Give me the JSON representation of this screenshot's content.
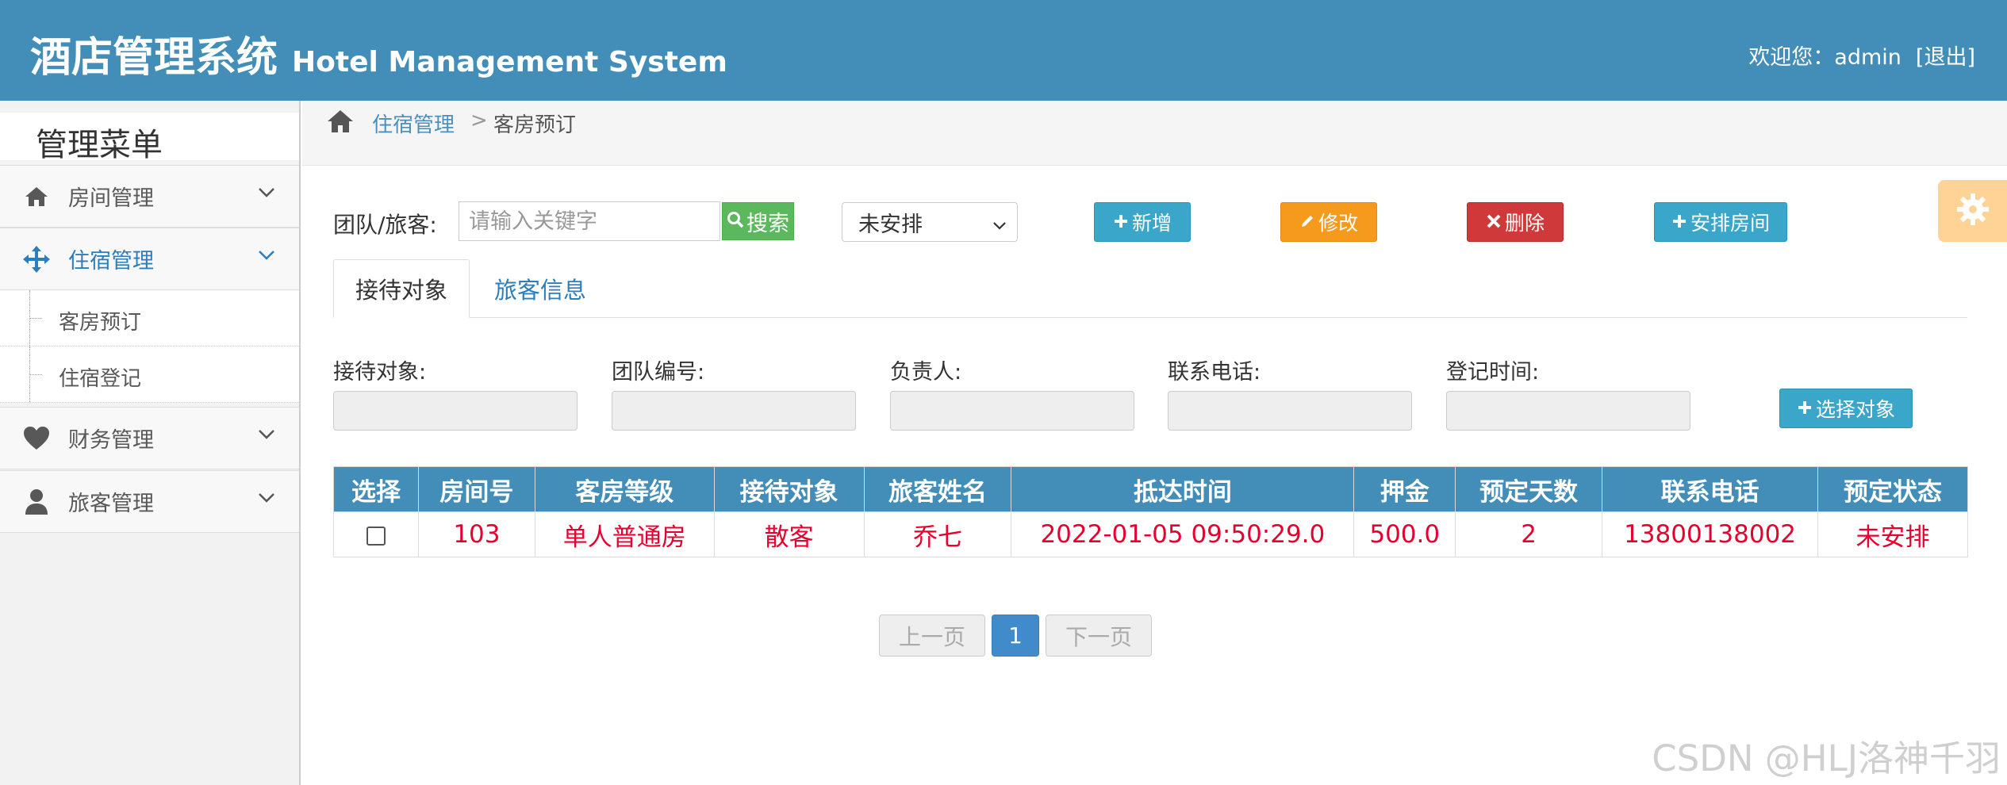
{
  "header": {
    "title_cn": "酒店管理系统",
    "title_en": "Hotel Management System",
    "welcome": "欢迎您：admin",
    "logout": "[退出]"
  },
  "sidebar": {
    "menu_title": "管理菜单",
    "items": [
      {
        "label": "房间管理",
        "icon": "home-icon"
      },
      {
        "label": "住宿管理",
        "icon": "arrows-move-icon",
        "active": true
      },
      {
        "label": "财务管理",
        "icon": "heart-icon"
      },
      {
        "label": "旅客管理",
        "icon": "user-icon"
      }
    ],
    "subitems": [
      {
        "label": "客房预订"
      },
      {
        "label": "住宿登记"
      }
    ]
  },
  "breadcrumb": {
    "parent": "住宿管理",
    "separator": ">",
    "current": "客房预订"
  },
  "toolbar": {
    "label": "团队/旅客:",
    "search_placeholder": "请输入关键字",
    "search_label": "搜索",
    "select_value": "未安排",
    "add_label": "新增",
    "edit_label": "修改",
    "delete_label": "删除",
    "arrange_label": "安排房间"
  },
  "tabs": [
    {
      "label": "接待对象"
    },
    {
      "label": "旅客信息"
    }
  ],
  "form": {
    "fields": [
      {
        "label": "接待对象:"
      },
      {
        "label": "团队编号:"
      },
      {
        "label": "负责人:"
      },
      {
        "label": "联系电话:"
      },
      {
        "label": "登记时间:"
      }
    ],
    "select_label": "选择对象"
  },
  "table": {
    "columns": [
      "选择",
      "房间号",
      "客房等级",
      "接待对象",
      "旅客姓名",
      "抵达时间",
      "押金",
      "预定天数",
      "联系电话",
      "预定状态"
    ],
    "rows": [
      [
        "",
        "103",
        "单人普通房",
        "散客",
        "乔七",
        "2022-01-05 09:50:29.0",
        "500.0",
        "2",
        "13800138002",
        "未安排"
      ]
    ]
  },
  "pagination": {
    "prev": "上一页",
    "current": "1",
    "next": "下一页"
  },
  "watermark": "CSDN @HLJ洛神千羽",
  "colors": {
    "header_bg": "#438eb9",
    "accent": "#2b7dbc",
    "row_text": "#e6002d",
    "add_btn": "#3aa6c9",
    "edit_btn": "#f59a1c",
    "delete_btn": "#d0393a",
    "search_btn": "#5cb85c"
  }
}
